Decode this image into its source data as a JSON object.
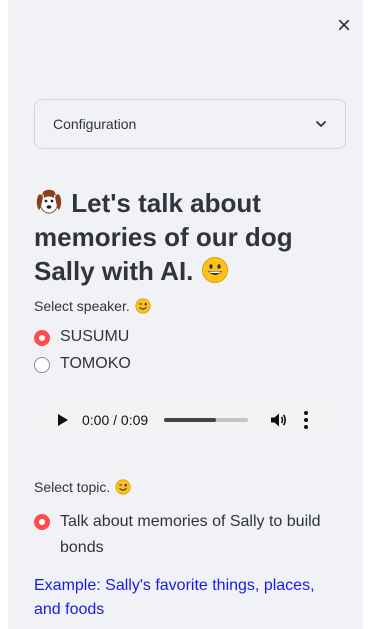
{
  "sidebar": {
    "close_label": "×",
    "expander": {
      "label": "Configuration"
    },
    "title": "Let's talk about memories of our dog Sally with AI.",
    "speaker": {
      "label": "Select speaker.",
      "options": [
        {
          "label": "SUSUMU",
          "selected": true
        },
        {
          "label": "TOMOKO",
          "selected": false
        }
      ]
    },
    "audio": {
      "time": "0:00 / 0:09",
      "progress": 0.62
    },
    "topic": {
      "label": "Select topic.",
      "options": [
        {
          "label": "Talk about memories of Sally to build bonds",
          "selected": true
        }
      ]
    },
    "example_link": "Example: Sally's favorite things, places, and foods"
  },
  "colors": {
    "accent": "#ff4b4b",
    "sidebar_bg": "#f0f2f6",
    "link": "#1a1ae6"
  },
  "icons": [
    "close-icon",
    "chevron-down-icon",
    "dog-icon",
    "grinning-face-icon",
    "winking-face-icon",
    "play-icon",
    "volume-icon",
    "more-options-icon"
  ]
}
